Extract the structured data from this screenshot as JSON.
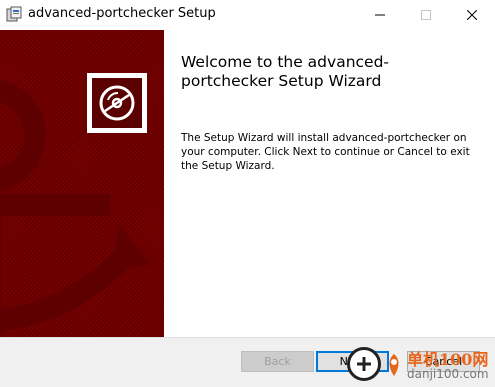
{
  "window": {
    "title": "advanced-portchecker Setup",
    "app_icon": "installer-icon",
    "controls": [
      "minimize-icon",
      "maximize-icon",
      "close-icon"
    ]
  },
  "banner": {
    "logo_icon": "disc-icon",
    "background_color": "#7a0000"
  },
  "content": {
    "title": "Welcome to the advanced-portchecker Setup Wizard",
    "body": "The Setup Wizard will install advanced-portchecker on your computer. Click Next to continue or Cancel to exit the Setup Wizard."
  },
  "buttons": {
    "back": "Back",
    "next": "Next",
    "cancel": "Cancel"
  },
  "watermark": {
    "brand": "单机100网",
    "domain": "danji100.com"
  },
  "colors": {
    "accent": "#0078d7",
    "banner": "#7a0000",
    "watermark_orange": "#e8651a"
  }
}
